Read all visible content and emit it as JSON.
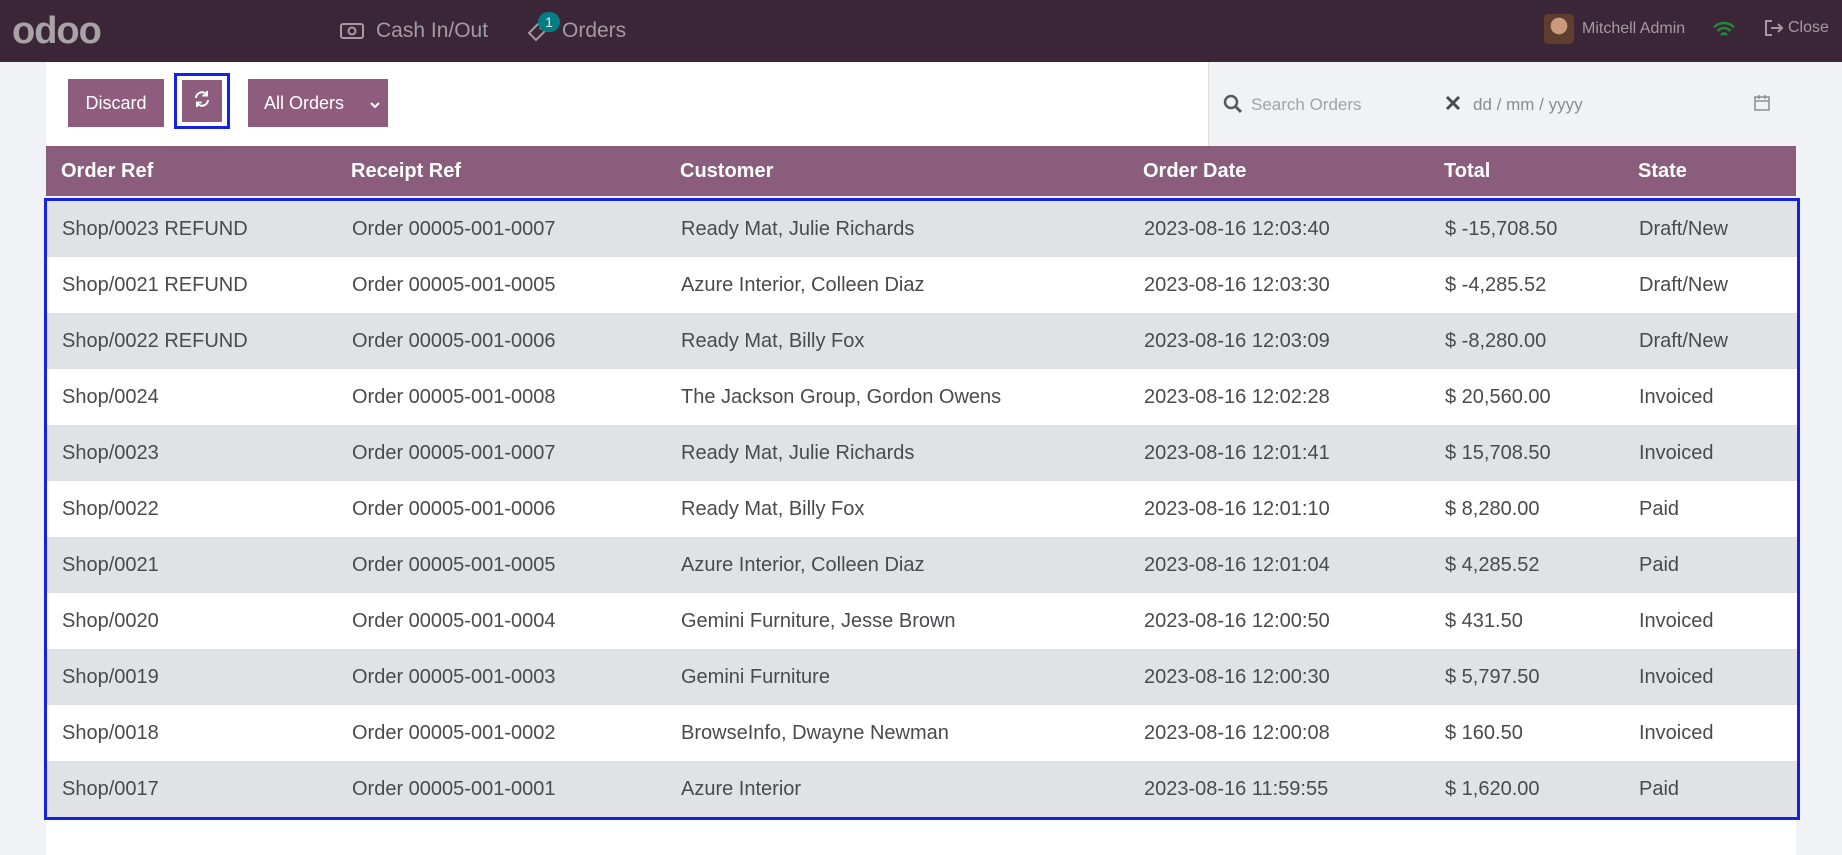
{
  "topbar": {
    "logo": "odoo",
    "nav": [
      {
        "label": "Cash In/Out",
        "icon": "cash-icon"
      },
      {
        "label": "Orders",
        "icon": "tag-icon",
        "badge": "1"
      }
    ],
    "user_name": "Mitchell Admin",
    "close_label": "Close"
  },
  "controls": {
    "discard_label": "Discard",
    "filter_label": "All Orders",
    "search_placeholder": "Search Orders",
    "date_placeholder": "dd / mm / yyyy"
  },
  "table": {
    "headers": [
      "Order Ref",
      "Receipt Ref",
      "Customer",
      "Order Date",
      "Total",
      "State"
    ],
    "rows": [
      {
        "order": "Shop/0023 REFUND",
        "receipt": "Order 00005-001-0007",
        "customer": "Ready Mat, Julie Richards",
        "date": "2023-08-16 12:03:40",
        "total": "$ -15,708.50",
        "state": "Draft/New"
      },
      {
        "order": "Shop/0021 REFUND",
        "receipt": "Order 00005-001-0005",
        "customer": "Azure Interior, Colleen Diaz",
        "date": "2023-08-16 12:03:30",
        "total": "$ -4,285.52",
        "state": "Draft/New"
      },
      {
        "order": "Shop/0022 REFUND",
        "receipt": "Order 00005-001-0006",
        "customer": "Ready Mat, Billy Fox",
        "date": "2023-08-16 12:03:09",
        "total": "$ -8,280.00",
        "state": "Draft/New"
      },
      {
        "order": "Shop/0024",
        "receipt": "Order 00005-001-0008",
        "customer": "The Jackson Group, Gordon Owens",
        "date": "2023-08-16 12:02:28",
        "total": "$ 20,560.00",
        "state": "Invoiced"
      },
      {
        "order": "Shop/0023",
        "receipt": "Order 00005-001-0007",
        "customer": "Ready Mat, Julie Richards",
        "date": "2023-08-16 12:01:41",
        "total": "$ 15,708.50",
        "state": "Invoiced"
      },
      {
        "order": "Shop/0022",
        "receipt": "Order 00005-001-0006",
        "customer": "Ready Mat, Billy Fox",
        "date": "2023-08-16 12:01:10",
        "total": "$ 8,280.00",
        "state": "Paid"
      },
      {
        "order": "Shop/0021",
        "receipt": "Order 00005-001-0005",
        "customer": "Azure Interior, Colleen Diaz",
        "date": "2023-08-16 12:01:04",
        "total": "$ 4,285.52",
        "state": "Paid"
      },
      {
        "order": "Shop/0020",
        "receipt": "Order 00005-001-0004",
        "customer": "Gemini Furniture, Jesse Brown",
        "date": "2023-08-16 12:00:50",
        "total": "$ 431.50",
        "state": "Invoiced"
      },
      {
        "order": "Shop/0019",
        "receipt": "Order 00005-001-0003",
        "customer": "Gemini Furniture",
        "date": "2023-08-16 12:00:30",
        "total": "$ 5,797.50",
        "state": "Invoiced"
      },
      {
        "order": "Shop/0018",
        "receipt": "Order 00005-001-0002",
        "customer": "BrowseInfo, Dwayne Newman",
        "date": "2023-08-16 12:00:08",
        "total": "$ 160.50",
        "state": "Invoiced"
      },
      {
        "order": "Shop/0017",
        "receipt": "Order 00005-001-0001",
        "customer": "Azure Interior",
        "date": "2023-08-16 11:59:55",
        "total": "$ 1,620.00",
        "state": "Paid"
      }
    ]
  },
  "colors": {
    "topbar": "#3a2637",
    "primary": "#8e5d7e",
    "highlight": "#1621e3",
    "badge": "#017e84"
  }
}
